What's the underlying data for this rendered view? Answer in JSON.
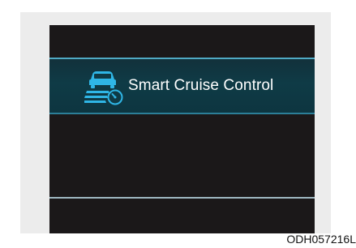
{
  "banner": {
    "label": "Smart Cruise Control",
    "icon": "smart-cruise-control-icon",
    "accent_color": "#4fa9c4"
  },
  "caption": {
    "code": "ODH057216L"
  }
}
